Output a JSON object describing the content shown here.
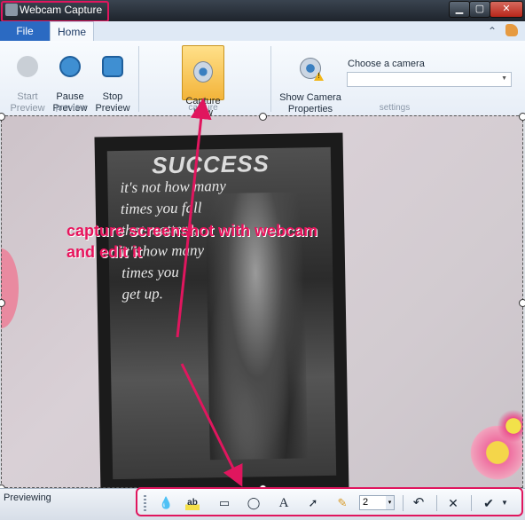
{
  "window": {
    "title": "Webcam Capture",
    "minimize": "▁",
    "maximize": "▢",
    "close": "✕"
  },
  "tabs": {
    "file": "File",
    "home": "Home",
    "collapse": "⌃"
  },
  "ribbon": {
    "preview_group": {
      "label": "preview",
      "start": "Start\nPreview",
      "pause": "Pause\nPreview",
      "stop": "Stop\nPreview"
    },
    "capture_group": {
      "label": "capture",
      "capture_now": "Capture\nNow"
    },
    "settings_group": {
      "label": "settings",
      "show_camera": "Show Camera\nProperties",
      "choose_label": "Choose a camera",
      "camera_value": ""
    }
  },
  "poster": {
    "title": "SUCCESS",
    "lines": [
      "it's not how many",
      "times you fall",
      "that matters,",
      "it's how many",
      "times you",
      "get up."
    ]
  },
  "annotation": "capture screenshot with webcam\nand edit it",
  "status": {
    "text": "Previewing"
  },
  "edit_toolbar": {
    "tools": [
      "drop-icon",
      "highlight-text-icon",
      "rectangle-icon",
      "ellipse-icon",
      "text-icon",
      "arrow-icon",
      "pencil-icon"
    ],
    "text_tool": "A",
    "brush_size": "2",
    "undo": "↶",
    "cancel": "✕",
    "accept": "✔"
  },
  "colors": {
    "accent": "#e0165e",
    "file_tab": "#2b6ac2",
    "capture_highlight": "#f3b43a"
  }
}
